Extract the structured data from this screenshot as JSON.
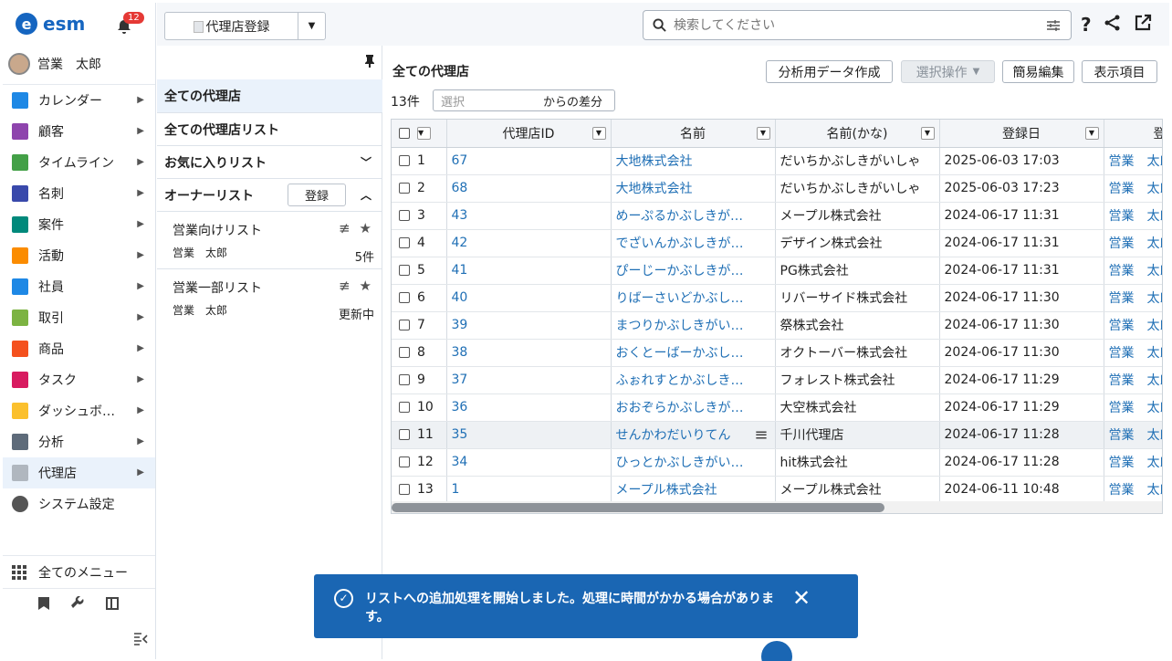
{
  "app": {
    "name": "esm",
    "notification_count": "12"
  },
  "user": {
    "name": "営業　太郎"
  },
  "sidebar": {
    "items": [
      {
        "label": "カレンダー",
        "icon": "calendar-icon",
        "color": "#1e88e5"
      },
      {
        "label": "顧客",
        "icon": "building-icon",
        "color": "#8e44ad"
      },
      {
        "label": "タイムライン",
        "icon": "chat-icon",
        "color": "#43a047"
      },
      {
        "label": "名刺",
        "icon": "card-icon",
        "color": "#3949ab"
      },
      {
        "label": "案件",
        "icon": "folder-icon",
        "color": "#00897b"
      },
      {
        "label": "活動",
        "icon": "clipboard-icon",
        "color": "#fb8c00"
      },
      {
        "label": "社員",
        "icon": "person-icon",
        "color": "#1e88e5"
      },
      {
        "label": "取引",
        "icon": "book-icon",
        "color": "#7cb342"
      },
      {
        "label": "商品",
        "icon": "box-icon",
        "color": "#f4511e"
      },
      {
        "label": "タスク",
        "icon": "check-icon",
        "color": "#d81b60"
      },
      {
        "label": "ダッシュボ…",
        "icon": "dashboard-icon",
        "color": "#fbc02d"
      },
      {
        "label": "分析",
        "icon": "chart-icon",
        "color": "#5e6b7a"
      },
      {
        "label": "代理店",
        "icon": "agency-icon",
        "color": "#b0b7bf"
      },
      {
        "label": "システム設定",
        "icon": "gear-icon",
        "color": "#555555"
      }
    ],
    "all_menu": "全てのメニュー"
  },
  "topbar": {
    "register_label": "代理店登録",
    "search_placeholder": "検索してください"
  },
  "lists": {
    "all_agencies": "全ての代理店",
    "all_agency_lists": "全ての代理店リスト",
    "favorites": "お気に入りリスト",
    "owner_lists": "オーナーリスト",
    "register_btn": "登録",
    "items": [
      {
        "name": "営業向けリスト",
        "owner": "営業　太郎",
        "count": "5件"
      },
      {
        "name": "営業一部リスト",
        "owner": "営業　太郎",
        "count": "更新中"
      }
    ]
  },
  "main": {
    "title": "全ての代理店",
    "buttons": {
      "analysis": "分析用データ作成",
      "select_ops": "選択操作",
      "quick_edit": "簡易編集",
      "columns": "表示項目"
    },
    "count": "13件",
    "diff_placeholder": "選択",
    "diff_suffix": "からの差分",
    "columns": [
      "代理店ID",
      "名前",
      "名前(かな)",
      "登録日",
      "登"
    ],
    "rows": [
      {
        "n": "1",
        "id": "67",
        "name": "大地株式会社",
        "kana": "だいちかぶしきがいしゃ",
        "date": "2025-06-03 17:03",
        "owner": "営業　太郎"
      },
      {
        "n": "2",
        "id": "68",
        "name": "大地株式会社",
        "kana": "だいちかぶしきがいしゃ",
        "date": "2025-06-03 17:23",
        "owner": "営業　太郎"
      },
      {
        "n": "3",
        "id": "43",
        "name": "めーぷるかぶしきが…",
        "kana": "メープル株式会社",
        "date": "2024-06-17 11:31",
        "owner": "営業　太郎"
      },
      {
        "n": "4",
        "id": "42",
        "name": "でざいんかぶしきが…",
        "kana": "デザイン株式会社",
        "date": "2024-06-17 11:31",
        "owner": "営業　太郎"
      },
      {
        "n": "5",
        "id": "41",
        "name": "ぴーじーかぶしきが…",
        "kana": "PG株式会社",
        "date": "2024-06-17 11:31",
        "owner": "営業　太郎"
      },
      {
        "n": "6",
        "id": "40",
        "name": "りばーさいどかぶし…",
        "kana": "リバーサイド株式会社",
        "date": "2024-06-17 11:30",
        "owner": "営業　太郎"
      },
      {
        "n": "7",
        "id": "39",
        "name": "まつりかぶしきがい…",
        "kana": "祭株式会社",
        "date": "2024-06-17 11:30",
        "owner": "営業　太郎"
      },
      {
        "n": "8",
        "id": "38",
        "name": "おくとーばーかぶし…",
        "kana": "オクトーバー株式会社",
        "date": "2024-06-17 11:30",
        "owner": "営業　太郎"
      },
      {
        "n": "9",
        "id": "37",
        "name": "ふぉれすとかぶしき…",
        "kana": "フォレスト株式会社",
        "date": "2024-06-17 11:29",
        "owner": "営業　太郎"
      },
      {
        "n": "10",
        "id": "36",
        "name": "おおぞらかぶしきが…",
        "kana": "大空株式会社",
        "date": "2024-06-17 11:29",
        "owner": "営業　太郎"
      },
      {
        "n": "11",
        "id": "35",
        "name": "せんかわだいりてん",
        "kana": "千川代理店",
        "date": "2024-06-17 11:28",
        "owner": "営業　太郎"
      },
      {
        "n": "12",
        "id": "34",
        "name": "ひっとかぶしきがい…",
        "kana": "hit株式会社",
        "date": "2024-06-17 11:28",
        "owner": "営業　太郎"
      },
      {
        "n": "13",
        "id": "1",
        "name": "メープル株式会社",
        "kana": "メープル株式会社",
        "date": "2024-06-11 10:48",
        "owner": "営業　太郎"
      }
    ]
  },
  "toast": {
    "message": "リストへの追加処理を開始しました。処理に時間がかかる場合があります。"
  }
}
